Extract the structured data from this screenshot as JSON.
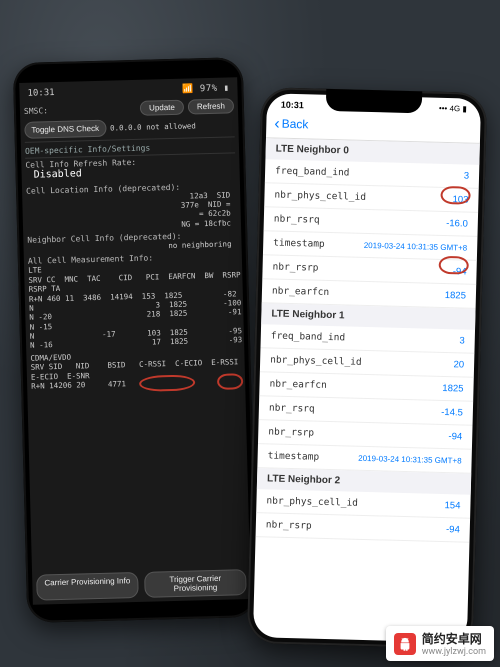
{
  "android": {
    "status": {
      "time": "10:31",
      "right": "📶 97% ▮"
    },
    "smsc_label": "SMSC:",
    "btn_update": "Update",
    "btn_refresh": "Refresh",
    "btn_toggle_dns": "Toggle DNS Check",
    "dns_text": "0.0.0.0 not allowed",
    "oem_heading": "OEM-specific Info/Settings",
    "refresh_label": "Cell Info Refresh Rate:",
    "refresh_value": "Disabled",
    "cell_loc_label": "Cell Location Info (deprecated):",
    "cell_loc_text1": "12a3  SID\n377e  NID =",
    "cell_loc_text2": "= 62c2b\nNG = 18cfbc",
    "neighbor_label": "Neighbor Cell Info (deprecated):",
    "neighbor_text": "no neighboring",
    "all_meas_label": "All Cell Measurement Info:",
    "lte_label": "LTE",
    "cols": "SRV CC  MNC  TAC    CID   PCI  EARFCN  BW  RSRP\nRSRP TA",
    "rows": [
      "R+N 460 11  3486  14194  153  1825         -82",
      "N                           3  1825        -100",
      "N -20                     218  1825         -91",
      "N -15",
      "N               -17       103  1825         -95",
      "N -16                      17  1825         -93"
    ],
    "cdma_label": "CDMA/EVDO",
    "cdma_cols": "SRV SID   NID    BSID   C-RSSI  C-ECIO  E-RSSI\nE-ECIO  E-SNR",
    "cdma_row": "R+N 14206 20     4771",
    "btn_carrier_info": "Carrier Provisioning Info",
    "btn_trigger": "Trigger Carrier\nProvisioning"
  },
  "iphone": {
    "status": {
      "time": "10:31",
      "right": "••• 4G ▮"
    },
    "back": "Back",
    "groups": [
      {
        "title": "LTE Neighbor 0",
        "rows": [
          {
            "k": "freq_band_ind",
            "v": "3"
          },
          {
            "k": "nbr_phys_cell_id",
            "v": "103"
          },
          {
            "k": "nbr_rsrq",
            "v": "-16.0"
          },
          {
            "k": "timestamp",
            "v": "2019-03-24 10:31:35 GMT+8"
          },
          {
            "k": "nbr_rsrp",
            "v": "-94"
          },
          {
            "k": "nbr_earfcn",
            "v": "1825"
          }
        ]
      },
      {
        "title": "LTE Neighbor 1",
        "rows": [
          {
            "k": "freq_band_ind",
            "v": "3"
          },
          {
            "k": "nbr_phys_cell_id",
            "v": "20"
          },
          {
            "k": "nbr_earfcn",
            "v": "1825"
          },
          {
            "k": "nbr_rsrq",
            "v": "-14.5"
          },
          {
            "k": "nbr_rsrp",
            "v": "-94"
          },
          {
            "k": "timestamp",
            "v": "2019-03-24 10:31:35 GMT+8"
          }
        ]
      },
      {
        "title": "LTE Neighbor 2",
        "rows": [
          {
            "k": "nbr_phys_cell_id",
            "v": "154"
          },
          {
            "k": "nbr_rsrp",
            "v": "-94"
          }
        ]
      }
    ]
  },
  "watermark": {
    "title": "简约安卓网",
    "url": "www.jylzwj.com"
  }
}
